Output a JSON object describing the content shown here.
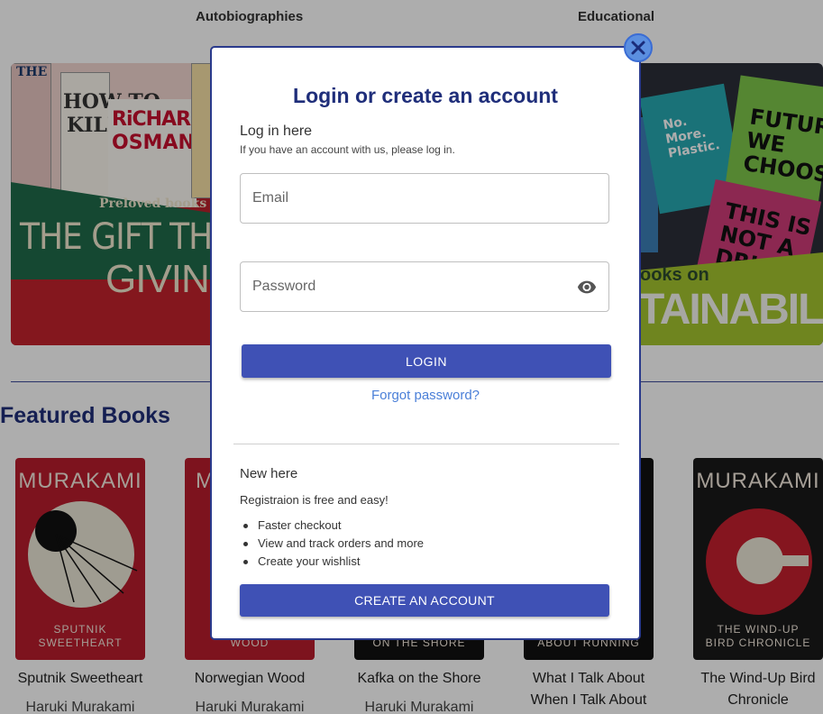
{
  "categories": {
    "autobiographies": "Autobiographies",
    "educational": "Educational"
  },
  "banners": {
    "left": {
      "preloved": "Preloved books",
      "headline_1": "THE GIFT THAT KEE",
      "headline_2": "GIVING",
      "book_osman_1": "RiCHARD",
      "book_osman_2": "OSMAN",
      "book_how_to": "HOW TO",
      "book_kill": "KILL",
      "book_the": "THE"
    },
    "right": {
      "caption_partial": "ooks on",
      "headline_partial": "TAINABILITY",
      "book_future": "FUTURE WE CHOOSE",
      "book_this": "THIS IS NOT A DRI",
      "book_plastic": "No. More. Plastic."
    }
  },
  "featured": {
    "heading": "Featured Books",
    "books": [
      {
        "cover_author": "MURAKAMI",
        "cover_sub_1": "SPUTNIK",
        "cover_sub_2": "SWEETHEART",
        "title_1": "Sputnik Sweetheart",
        "title_2": "",
        "author": "Haruki Murakami"
      },
      {
        "cover_author": "M",
        "cover_sub_1": "",
        "cover_sub_2": "WOOD",
        "title_1": "Norwegian Wood",
        "title_2": "",
        "author": "Haruki Murakami"
      },
      {
        "cover_author": "",
        "cover_sub_1": "",
        "cover_sub_2": "ON THE SHORE",
        "title_1": "Kafka on the Shore",
        "title_2": "",
        "author": "Haruki Murakami"
      },
      {
        "cover_author": "",
        "cover_sub_1": "",
        "cover_sub_2": "ABOUT RUNNING",
        "title_1": "What I Talk About",
        "title_2": "When I Talk About",
        "author": ""
      },
      {
        "cover_author": "MURAKAMI",
        "cover_sub_1": "THE WIND-UP",
        "cover_sub_2": "BIRD CHRONICLE",
        "title_1": "The Wind-Up Bird",
        "title_2": "Chronicle",
        "author": ""
      }
    ]
  },
  "modal": {
    "title": "Login or create an account",
    "login_heading": "Log in here",
    "login_subtext": "If you have an account with us, please log in.",
    "email_placeholder": "Email",
    "password_placeholder": "Password",
    "login_button": "LOGIN",
    "forgot_link": "Forgot password?",
    "new_heading": "New here",
    "new_subtext": "Registraion is free and easy!",
    "benefits": [
      "Faster checkout",
      "View and track orders and more",
      "Create your wishlist"
    ],
    "create_button": "CREATE AN ACCOUNT",
    "close_icon": "close-icon",
    "eye_icon": "eye-icon"
  },
  "colors": {
    "primary_button": "#3f51b5",
    "heading_navy": "#1f2e7a",
    "link_blue": "#4a7fd8",
    "close_button": "#5b8fe0"
  }
}
